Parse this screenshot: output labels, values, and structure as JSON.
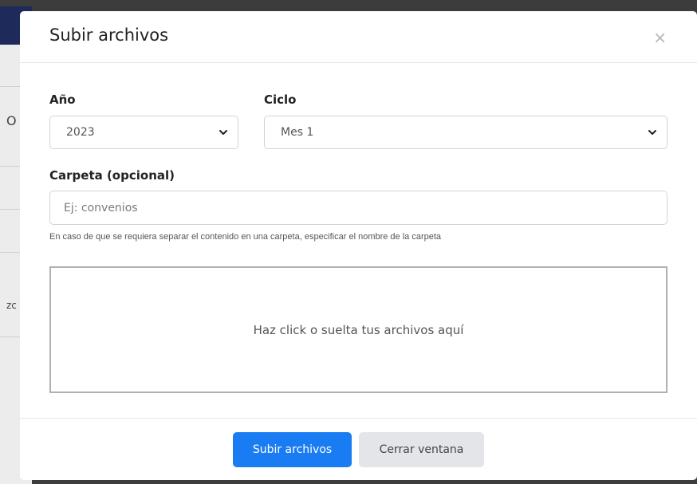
{
  "background": {
    "chars": [
      "O",
      "zc"
    ]
  },
  "modal": {
    "title": "Subir archivos",
    "close_symbol": "×",
    "year": {
      "label": "Año",
      "value": "2023"
    },
    "cycle": {
      "label": "Ciclo",
      "value": "Mes 1"
    },
    "folder": {
      "label": "Carpeta (opcional)",
      "placeholder": "Ej: convenios",
      "help": "En caso de que se requiera separar el contenido en una carpeta, especificar el nombre de la carpeta"
    },
    "dropzone_text": "Haz click o suelta tus archivos aquí",
    "buttons": {
      "upload": "Subir archivos",
      "close": "Cerrar ventana"
    }
  },
  "colors": {
    "primary": "#1a7cf3",
    "secondary": "#e3e5e8",
    "topbar": "#1e2a5a"
  }
}
